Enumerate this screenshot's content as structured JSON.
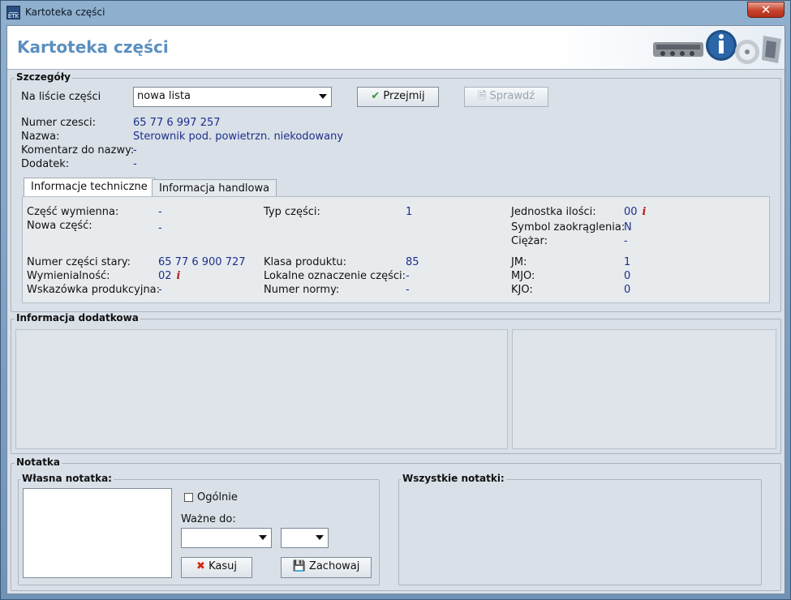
{
  "window": {
    "title": "Kartoteka części",
    "app_icon_text": "ETK",
    "close_symbol": "✕"
  },
  "header": {
    "title": "Kartoteka części"
  },
  "details": {
    "group_label": "Szczegóły",
    "list_label": "Na liście części",
    "list_value": "nowa lista",
    "accept_button": "Przejmij",
    "check_button": "Sprawdź",
    "fields": [
      {
        "label": "Numer czesci:",
        "value": "65 77 6 997 257"
      },
      {
        "label": "Nazwa:",
        "value": "Sterownik pod. powietrzn. niekodowany"
      },
      {
        "label": "Komentarz do nazwy:",
        "value": "-"
      },
      {
        "label": "Dodatek:",
        "value": "-"
      }
    ]
  },
  "tabs": [
    {
      "label": "Informacje techniczne",
      "active": true
    },
    {
      "label": "Informacja handlowa",
      "active": false
    }
  ],
  "tech": {
    "col1": [
      {
        "label": "Część wymienna:",
        "value": "-"
      },
      {
        "label": "Nowa część:",
        "value": "-"
      },
      {
        "label": "Numer części stary:",
        "value": "65 77 6 900 727"
      },
      {
        "label": "Wymienialność:",
        "value": "02"
      },
      {
        "label": "Wskazówka produkcyjna:",
        "value": "-"
      }
    ],
    "col2": [
      {
        "label": "Typ części:",
        "value": "1"
      },
      {
        "label": "Klasa produktu:",
        "value": "85"
      },
      {
        "label": "Lokalne oznaczenie części:",
        "value": "-"
      },
      {
        "label": "Numer normy:",
        "value": "-"
      }
    ],
    "col3": [
      {
        "label": "Jednostka ilości:",
        "value": "00"
      },
      {
        "label": "Symbol zaokrąglenia:",
        "value": "N"
      },
      {
        "label": "Ciężar:",
        "value": "-"
      },
      {
        "label": "JM:",
        "value": "1"
      },
      {
        "label": "MJO:",
        "value": "0"
      },
      {
        "label": "KJO:",
        "value": "0"
      }
    ]
  },
  "additional": {
    "group_label": "Informacja dodatkowa"
  },
  "notes": {
    "group_label": "Notatka",
    "own_label": "Własna notatka:",
    "general_checkbox": "Ogólnie",
    "valid_to_label": "Ważne do:",
    "delete_button": "Kasuj",
    "save_button": "Zachowaj",
    "all_label": "Wszystkie notatki:"
  },
  "colors": {
    "accent": "#5b8fc0",
    "value_text": "#1c2f8a",
    "info_icon": "#b81c1c"
  }
}
